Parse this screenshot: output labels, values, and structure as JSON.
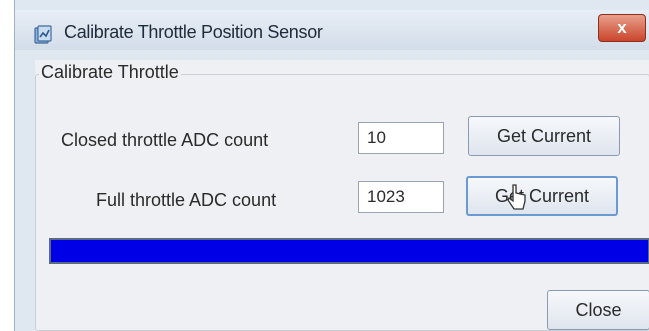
{
  "window": {
    "title": "Calibrate Throttle Position Sensor",
    "close_glyph": "x"
  },
  "group": {
    "label": "Calibrate Throttle"
  },
  "closed": {
    "label": "Closed throttle ADC count",
    "value": "10",
    "button": "Get Current"
  },
  "full": {
    "label": "Full throttle ADC count",
    "value": "1023",
    "button": "Get Current"
  },
  "progress": {
    "fraction": 1.0,
    "fill_color": "#0000e6"
  },
  "footer": {
    "close_label": "Close"
  },
  "icons": {
    "app": "calibration-icon",
    "cursor": "mouse-pointer-icon"
  }
}
